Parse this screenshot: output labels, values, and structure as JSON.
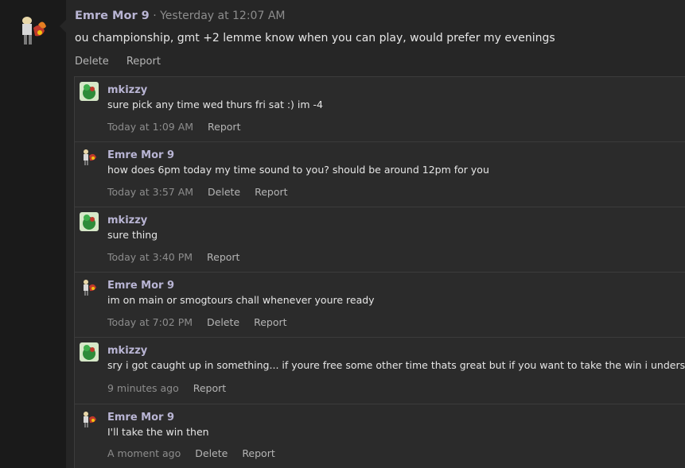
{
  "post": {
    "author": "Emre Mor 9",
    "separator": "·",
    "time": "Yesterday at 12:07 AM",
    "body": "ou championship, gmt +2 lemme know when you can play, would prefer my evenings",
    "actions": {
      "delete": "Delete",
      "report": "Report"
    }
  },
  "replies": [
    {
      "author": "mkizzy",
      "text": "sure pick any time wed thurs fri sat :) im -4",
      "time": "Today at 1:09 AM",
      "delete": "",
      "report": "Report",
      "avatar": "green-character"
    },
    {
      "author": "Emre Mor 9",
      "text": "how does 6pm today my time sound to you? should be around 12pm for you",
      "time": "Today at 3:57 AM",
      "delete": "Delete",
      "report": "Report",
      "avatar": "fire-character"
    },
    {
      "author": "mkizzy",
      "text": "sure thing",
      "time": "Today at 3:40 PM",
      "delete": "",
      "report": "Report",
      "avatar": "green-character"
    },
    {
      "author": "Emre Mor 9",
      "text": "im on main or smogtours chall whenever youre ready",
      "time": "Today at 7:02 PM",
      "delete": "Delete",
      "report": "Report",
      "avatar": "fire-character"
    },
    {
      "author": "mkizzy",
      "text": "sry i got caught up in something... if youre free some other time thats great but if you want to take the win i understand",
      "time": "9 minutes ago",
      "delete": "",
      "report": "Report",
      "avatar": "green-character"
    },
    {
      "author": "Emre Mor 9",
      "text": "I'll take the win then",
      "time": "A moment ago",
      "delete": "Delete",
      "report": "Report",
      "avatar": "fire-character"
    }
  ]
}
